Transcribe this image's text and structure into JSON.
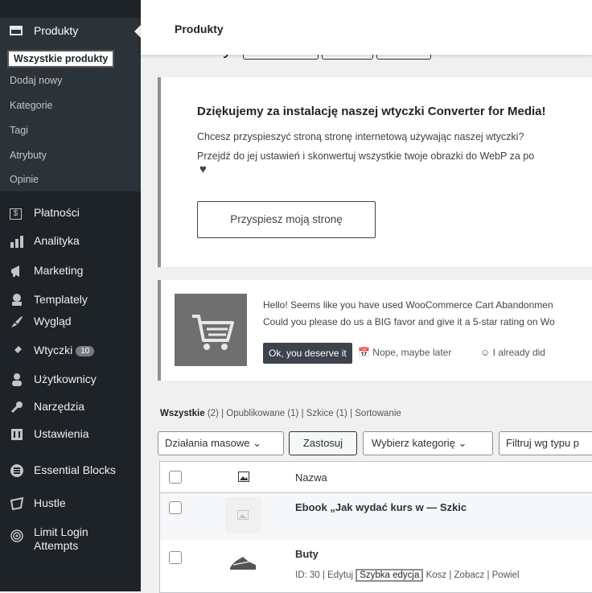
{
  "sidebar": {
    "current_menu": "Produkty",
    "submenu": [
      "Wszystkie produkty",
      "Dodaj nowy",
      "Kategorie",
      "Tagi",
      "Atrybuty",
      "Opinie"
    ],
    "items": [
      {
        "label": "Płatności",
        "icon": "payments-icon"
      },
      {
        "label": "Analityka",
        "icon": "analytics-icon"
      },
      {
        "label": "Marketing",
        "icon": "marketing-icon"
      },
      {
        "label": "Templately",
        "icon": "templately-icon"
      },
      {
        "label": "Wygląd",
        "icon": "appearance-icon"
      },
      {
        "label": "Wtyczki",
        "icon": "plugins-icon",
        "badge": "10"
      },
      {
        "label": "Użytkownicy",
        "icon": "users-icon"
      },
      {
        "label": "Narzędzia",
        "icon": "tools-icon"
      },
      {
        "label": "Ustawienia",
        "icon": "settings-icon"
      },
      {
        "label": "Essential Blocks",
        "icon": "essential-blocks-icon"
      },
      {
        "label": "Hustle",
        "icon": "hustle-icon"
      },
      {
        "label": "Limit Login Attempts",
        "icon": "fingerprint-icon"
      }
    ]
  },
  "topbar": {
    "title": "Produkty"
  },
  "page_title": "Produkty",
  "notice_converter": {
    "title": "Dziękujemy za instalację naszej wtyczki Converter for Media!",
    "line1": "Chcesz przyspieszyć stroną stronę internetową używając naszej wtyczki?",
    "line2": "Przejdź do jej ustawień i skonwertuj wszystkie twoje obrazki do WebP za po",
    "button": "Przyspiesz moją stronę"
  },
  "notice_review": {
    "line1": "Hello! Seems like you have used WooCommerce Cart Abandonmen",
    "line2": "Could you please do us a BIG favor and give it a 5-star rating on Wo",
    "ok": "Ok, you deserve it",
    "later": "Nope, maybe later",
    "did": "I already did"
  },
  "filters": {
    "all": "Wszystkie",
    "all_count": "(2)",
    "rest": " | Opublikowane (1) | Szkice (1) | Sortowanie",
    "bulk": "Działania masowe",
    "apply": "Zastosuj",
    "category": "Wybierz kategorię",
    "type": "Filtruj wg typu p"
  },
  "table": {
    "col_name": "Nazwa",
    "rows": [
      {
        "name": "Ebook „Jak wydać kurs w — Szkic"
      },
      {
        "name": "Buty",
        "meta": "ID: 30 | Edytuj",
        "quick": "Szybka edycja",
        "after": "Kosz | Zobacz | Powiel"
      }
    ]
  }
}
